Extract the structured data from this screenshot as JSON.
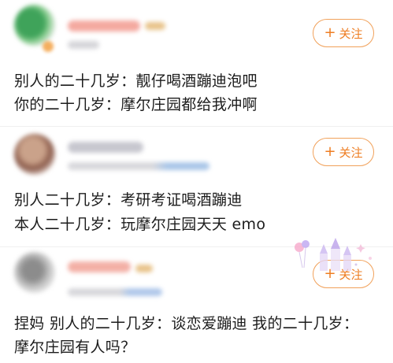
{
  "follow_label": "关注",
  "posts": [
    {
      "lines": [
        "别人的二十几岁：靓仔喝酒蹦迪泡吧",
        "你的二十几岁：摩尔庄园都给我冲啊"
      ]
    },
    {
      "lines": [
        "别人二十几岁：考研考证喝酒蹦迪",
        "本人二十几岁：玩摩尔庄园天天 emo"
      ]
    },
    {
      "lines": [
        "捏妈 别人的二十几岁：谈恋爱蹦迪 我的二十几岁：",
        "摩尔庄园有人吗？"
      ]
    }
  ],
  "colors": {
    "accent": "#ee7d22",
    "accent_border": "#f1a15a",
    "text": "#1c1c1c"
  },
  "icons": {
    "follow": "plus-icon",
    "decoration": "castle-balloon-decoration"
  }
}
